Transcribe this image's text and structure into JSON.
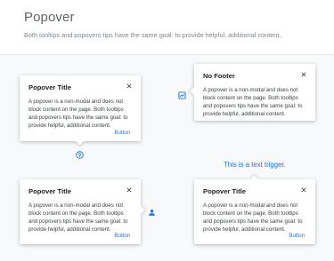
{
  "header": {
    "title": "Popover",
    "subtitle": "Both tooltips and popovers tips have the same goal: to provide helpful, additional content."
  },
  "popovers": [
    {
      "title": "Popover Title",
      "body": "A popover is a non-modal and does not block content on the page. Both tooltips and popovers tips have the same goal: to provide helpful, additional content.",
      "button": "Button",
      "close": "✕",
      "trigger_icon": "help-circle-icon"
    },
    {
      "title": "No Footer",
      "body": "A popover is a non-modal and does not block content on the page. Both tooltips and popovers tips have the same goal: to provide helpful, additional content.",
      "close": "✕",
      "trigger_icon": "chart-icon"
    },
    {
      "title": "Popover Title",
      "body": "A popover is a non-modal and does not block content on the page. Both tooltips and popovers tips have the same goal: to provide helpful, additional content.",
      "button": "Button",
      "close": "✕",
      "trigger_icon": "person-icon"
    },
    {
      "title": "Popover Title",
      "body": "A popover is a non-modal and does not block content on the page. Both tooltips and popovers tips have the same goal: to provide helpful, additional content.",
      "button": "Button",
      "close": "✕",
      "trigger_text": "This is a text trigger."
    }
  ],
  "colors": {
    "accent": "#1a73e8",
    "background": "#f8f9fa"
  }
}
